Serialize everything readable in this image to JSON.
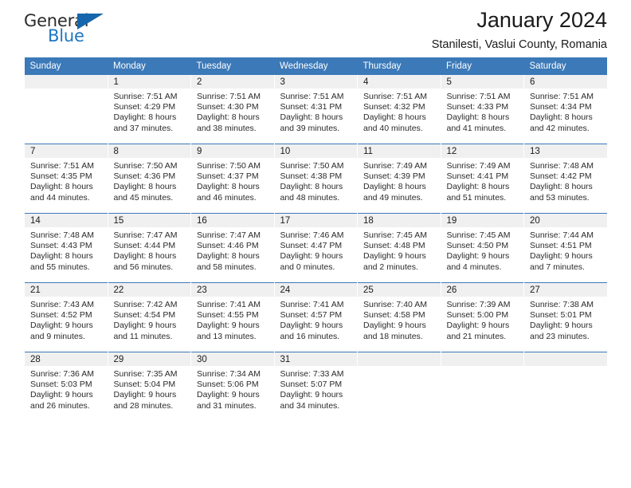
{
  "logo": {
    "word1": "General",
    "word2": "Blue",
    "triangle_color": "#1566ad",
    "word2_color": "#1f77c0"
  },
  "header": {
    "title": "January 2024",
    "subtitle": "Stanilesti, Vaslui County, Romania"
  },
  "theme": {
    "header_bg": "#3b79b8",
    "daynum_bg": "#f0f0f0",
    "grid_line": "#3b79b8"
  },
  "weekdays": [
    "Sunday",
    "Monday",
    "Tuesday",
    "Wednesday",
    "Thursday",
    "Friday",
    "Saturday"
  ],
  "labels": {
    "sunrise": "Sunrise:",
    "sunset": "Sunset:",
    "daylight": "Daylight:"
  },
  "weeks": [
    [
      {
        "day": "",
        "blank": true,
        "l1": "",
        "l2": "",
        "l3": "",
        "l4": ""
      },
      {
        "day": "1",
        "l1": "Sunrise: 7:51 AM",
        "l2": "Sunset: 4:29 PM",
        "l3": "Daylight: 8 hours",
        "l4": "and 37 minutes."
      },
      {
        "day": "2",
        "l1": "Sunrise: 7:51 AM",
        "l2": "Sunset: 4:30 PM",
        "l3": "Daylight: 8 hours",
        "l4": "and 38 minutes."
      },
      {
        "day": "3",
        "l1": "Sunrise: 7:51 AM",
        "l2": "Sunset: 4:31 PM",
        "l3": "Daylight: 8 hours",
        "l4": "and 39 minutes."
      },
      {
        "day": "4",
        "l1": "Sunrise: 7:51 AM",
        "l2": "Sunset: 4:32 PM",
        "l3": "Daylight: 8 hours",
        "l4": "and 40 minutes."
      },
      {
        "day": "5",
        "l1": "Sunrise: 7:51 AM",
        "l2": "Sunset: 4:33 PM",
        "l3": "Daylight: 8 hours",
        "l4": "and 41 minutes."
      },
      {
        "day": "6",
        "l1": "Sunrise: 7:51 AM",
        "l2": "Sunset: 4:34 PM",
        "l3": "Daylight: 8 hours",
        "l4": "and 42 minutes."
      }
    ],
    [
      {
        "day": "7",
        "l1": "Sunrise: 7:51 AM",
        "l2": "Sunset: 4:35 PM",
        "l3": "Daylight: 8 hours",
        "l4": "and 44 minutes."
      },
      {
        "day": "8",
        "l1": "Sunrise: 7:50 AM",
        "l2": "Sunset: 4:36 PM",
        "l3": "Daylight: 8 hours",
        "l4": "and 45 minutes."
      },
      {
        "day": "9",
        "l1": "Sunrise: 7:50 AM",
        "l2": "Sunset: 4:37 PM",
        "l3": "Daylight: 8 hours",
        "l4": "and 46 minutes."
      },
      {
        "day": "10",
        "l1": "Sunrise: 7:50 AM",
        "l2": "Sunset: 4:38 PM",
        "l3": "Daylight: 8 hours",
        "l4": "and 48 minutes."
      },
      {
        "day": "11",
        "l1": "Sunrise: 7:49 AM",
        "l2": "Sunset: 4:39 PM",
        "l3": "Daylight: 8 hours",
        "l4": "and 49 minutes."
      },
      {
        "day": "12",
        "l1": "Sunrise: 7:49 AM",
        "l2": "Sunset: 4:41 PM",
        "l3": "Daylight: 8 hours",
        "l4": "and 51 minutes."
      },
      {
        "day": "13",
        "l1": "Sunrise: 7:48 AM",
        "l2": "Sunset: 4:42 PM",
        "l3": "Daylight: 8 hours",
        "l4": "and 53 minutes."
      }
    ],
    [
      {
        "day": "14",
        "l1": "Sunrise: 7:48 AM",
        "l2": "Sunset: 4:43 PM",
        "l3": "Daylight: 8 hours",
        "l4": "and 55 minutes."
      },
      {
        "day": "15",
        "l1": "Sunrise: 7:47 AM",
        "l2": "Sunset: 4:44 PM",
        "l3": "Daylight: 8 hours",
        "l4": "and 56 minutes."
      },
      {
        "day": "16",
        "l1": "Sunrise: 7:47 AM",
        "l2": "Sunset: 4:46 PM",
        "l3": "Daylight: 8 hours",
        "l4": "and 58 minutes."
      },
      {
        "day": "17",
        "l1": "Sunrise: 7:46 AM",
        "l2": "Sunset: 4:47 PM",
        "l3": "Daylight: 9 hours",
        "l4": "and 0 minutes."
      },
      {
        "day": "18",
        "l1": "Sunrise: 7:45 AM",
        "l2": "Sunset: 4:48 PM",
        "l3": "Daylight: 9 hours",
        "l4": "and 2 minutes."
      },
      {
        "day": "19",
        "l1": "Sunrise: 7:45 AM",
        "l2": "Sunset: 4:50 PM",
        "l3": "Daylight: 9 hours",
        "l4": "and 4 minutes."
      },
      {
        "day": "20",
        "l1": "Sunrise: 7:44 AM",
        "l2": "Sunset: 4:51 PM",
        "l3": "Daylight: 9 hours",
        "l4": "and 7 minutes."
      }
    ],
    [
      {
        "day": "21",
        "l1": "Sunrise: 7:43 AM",
        "l2": "Sunset: 4:52 PM",
        "l3": "Daylight: 9 hours",
        "l4": "and 9 minutes."
      },
      {
        "day": "22",
        "l1": "Sunrise: 7:42 AM",
        "l2": "Sunset: 4:54 PM",
        "l3": "Daylight: 9 hours",
        "l4": "and 11 minutes."
      },
      {
        "day": "23",
        "l1": "Sunrise: 7:41 AM",
        "l2": "Sunset: 4:55 PM",
        "l3": "Daylight: 9 hours",
        "l4": "and 13 minutes."
      },
      {
        "day": "24",
        "l1": "Sunrise: 7:41 AM",
        "l2": "Sunset: 4:57 PM",
        "l3": "Daylight: 9 hours",
        "l4": "and 16 minutes."
      },
      {
        "day": "25",
        "l1": "Sunrise: 7:40 AM",
        "l2": "Sunset: 4:58 PM",
        "l3": "Daylight: 9 hours",
        "l4": "and 18 minutes."
      },
      {
        "day": "26",
        "l1": "Sunrise: 7:39 AM",
        "l2": "Sunset: 5:00 PM",
        "l3": "Daylight: 9 hours",
        "l4": "and 21 minutes."
      },
      {
        "day": "27",
        "l1": "Sunrise: 7:38 AM",
        "l2": "Sunset: 5:01 PM",
        "l3": "Daylight: 9 hours",
        "l4": "and 23 minutes."
      }
    ],
    [
      {
        "day": "28",
        "l1": "Sunrise: 7:36 AM",
        "l2": "Sunset: 5:03 PM",
        "l3": "Daylight: 9 hours",
        "l4": "and 26 minutes."
      },
      {
        "day": "29",
        "l1": "Sunrise: 7:35 AM",
        "l2": "Sunset: 5:04 PM",
        "l3": "Daylight: 9 hours",
        "l4": "and 28 minutes."
      },
      {
        "day": "30",
        "l1": "Sunrise: 7:34 AM",
        "l2": "Sunset: 5:06 PM",
        "l3": "Daylight: 9 hours",
        "l4": "and 31 minutes."
      },
      {
        "day": "31",
        "l1": "Sunrise: 7:33 AM",
        "l2": "Sunset: 5:07 PM",
        "l3": "Daylight: 9 hours",
        "l4": "and 34 minutes."
      },
      {
        "day": "",
        "blank": true,
        "l1": "",
        "l2": "",
        "l3": "",
        "l4": ""
      },
      {
        "day": "",
        "blank": true,
        "l1": "",
        "l2": "",
        "l3": "",
        "l4": ""
      },
      {
        "day": "",
        "blank": true,
        "l1": "",
        "l2": "",
        "l3": "",
        "l4": ""
      }
    ]
  ]
}
